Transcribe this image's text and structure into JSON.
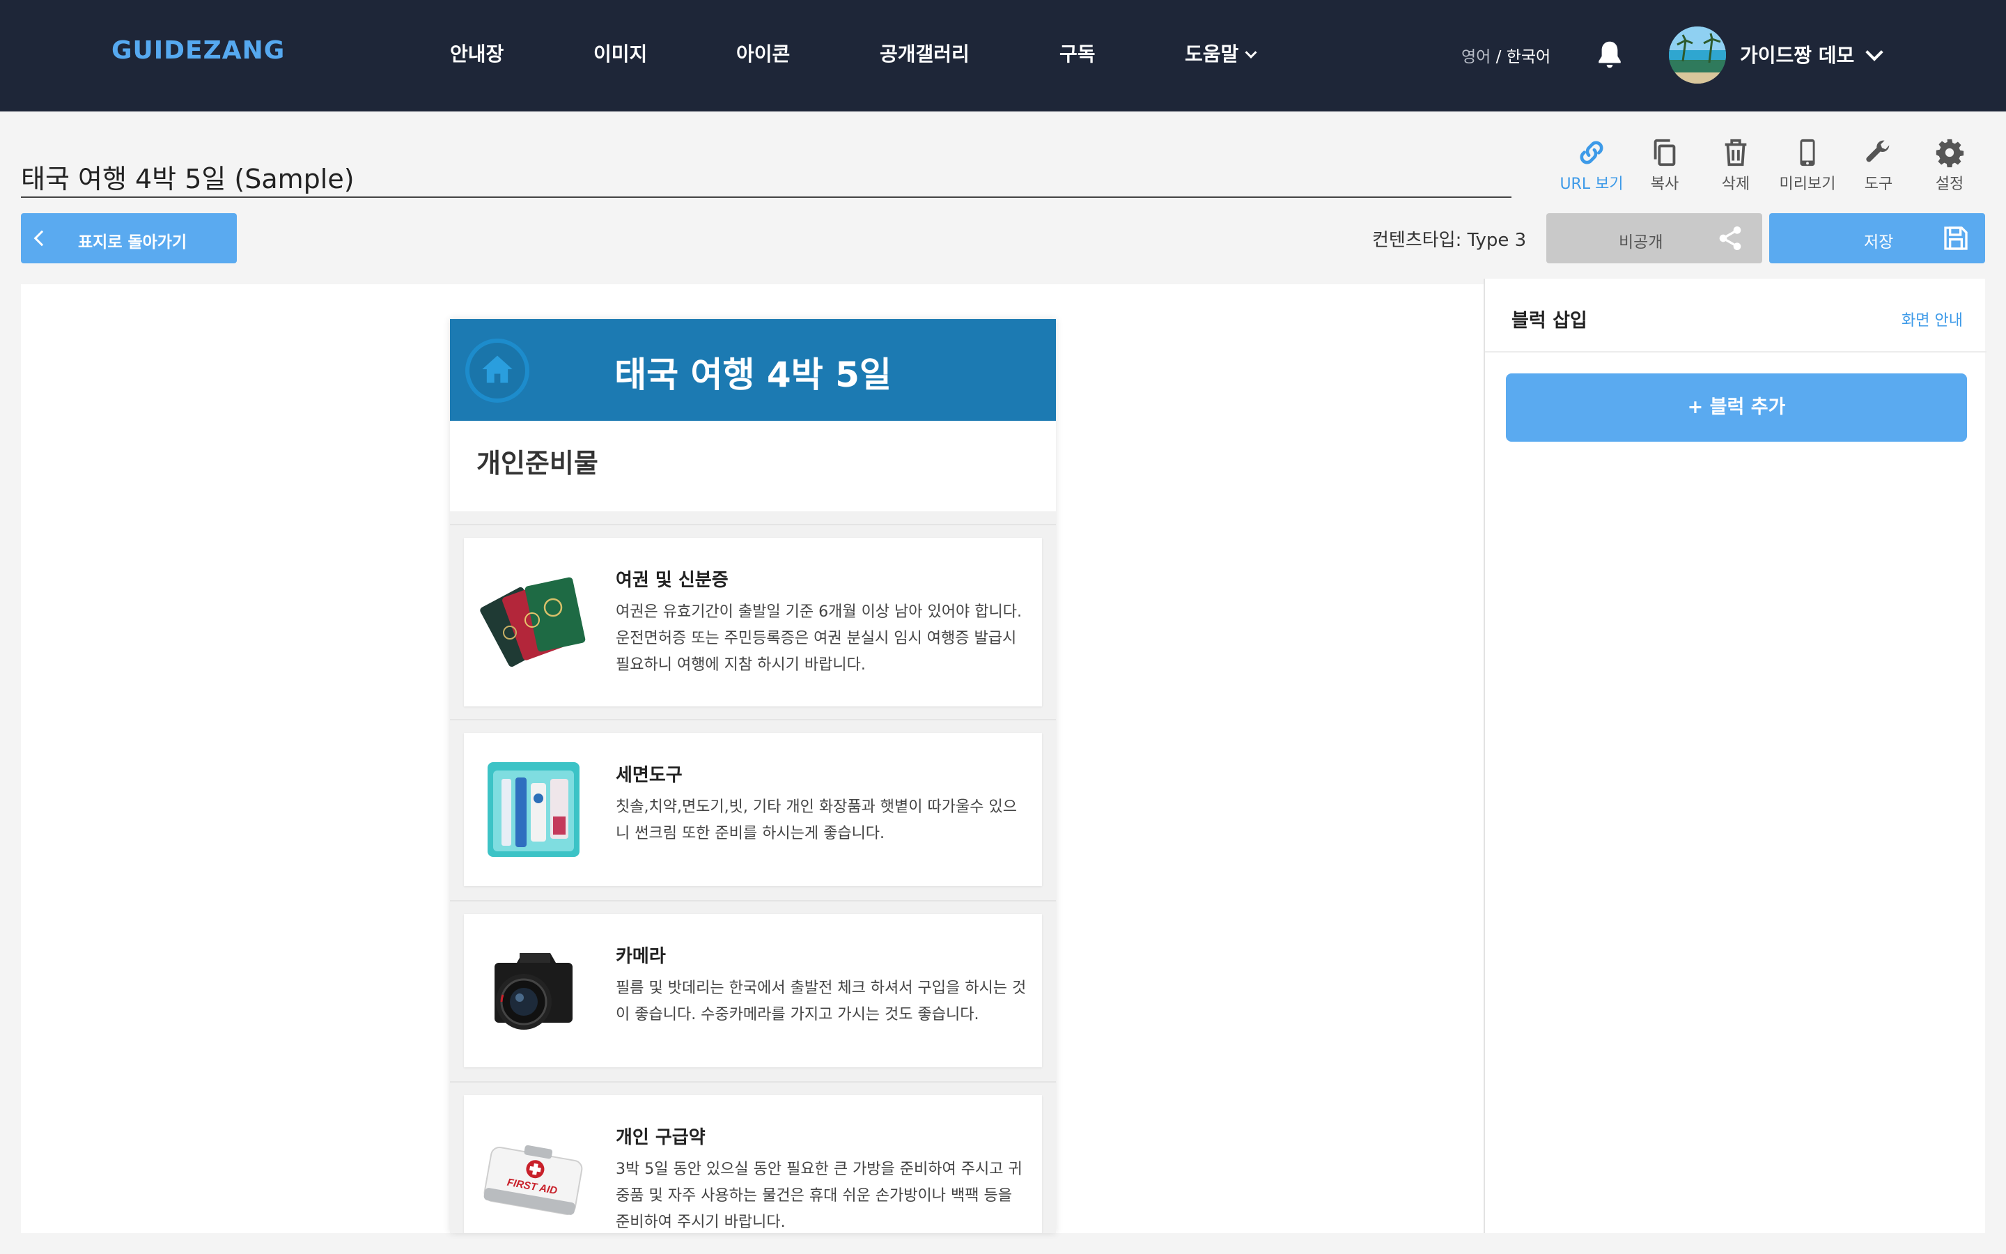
{
  "navbar": {
    "logo": "GUIDEZANG",
    "menu": [
      {
        "label": "안내장"
      },
      {
        "label": "이미지"
      },
      {
        "label": "아이콘"
      },
      {
        "label": "공개갤러리"
      },
      {
        "label": "구독"
      },
      {
        "label": "도움말"
      }
    ],
    "lang_inactive": "영어",
    "lang_sep": " / ",
    "lang_active": "한국어",
    "user_name": "가이드짱 데모",
    "icons": [
      "bell-icon",
      "chevron-down-icon"
    ]
  },
  "header": {
    "doc_title": "태국 여행 4박 5일 (Sample)",
    "tools": [
      {
        "label": "URL 보기",
        "icon": "link-icon"
      },
      {
        "label": "복사",
        "icon": "copy-icon"
      },
      {
        "label": "삭제",
        "icon": "trash-icon"
      },
      {
        "label": "미리보기",
        "icon": "mobile-icon"
      },
      {
        "label": "도구",
        "icon": "wrench-icon"
      },
      {
        "label": "설정",
        "icon": "gear-icon"
      }
    ],
    "back_label": "표지로 돌아가기",
    "content_type": "컨텐츠타입: Type 3",
    "private_label": "비공개",
    "save_label": "저장"
  },
  "phone": {
    "title": "태국 여행 4박 5일",
    "section_title": "개인준비물",
    "items": [
      {
        "title": "여권 및 신분증",
        "desc": "여권은 유효기간이 출발일 기준 6개월 이상 남아 있어야 합니다. 운전면허증 또는 주민등록증은 여권 분실시 임시 여행증 발급시 필요하니 여행에 지참 하시기 바랍니다.",
        "image": "passport-image"
      },
      {
        "title": "세면도구",
        "desc": "칫솔,치약,면도기,빗, 기타 개인 화장품과 햇볕이 따가울수 있으니 썬크림 또한 준비를 하시는게 좋습니다.",
        "image": "toiletries-image"
      },
      {
        "title": "카메라",
        "desc": "필름 및 밧데리는 한국에서 출발전 체크 하셔서 구입을 하시는 것이 좋습니다. 수중카메라를 가지고 가시는 것도 좋습니다.",
        "image": "camera-image"
      },
      {
        "title": "개인 구급약",
        "desc": "3박 5일 동안 있으실 동안 필요한 큰 가방을 준비하여 주시고 귀중품 및 자주 사용하는 물건은 휴대 쉬운 손가방이나 백팩 등을 준비하여 주시기 바랍니다.",
        "image": "first-aid-image",
        "image_text": "FIRST AID"
      }
    ]
  },
  "side": {
    "title": "블럭 삽입",
    "help": "화면 안내",
    "add_block": "+ 블럭 추가"
  },
  "colors": {
    "navbar": "#1e2638",
    "accent": "#5aaaf0",
    "phone_header": "#1c7ab2",
    "logo": "#56a9f0"
  }
}
